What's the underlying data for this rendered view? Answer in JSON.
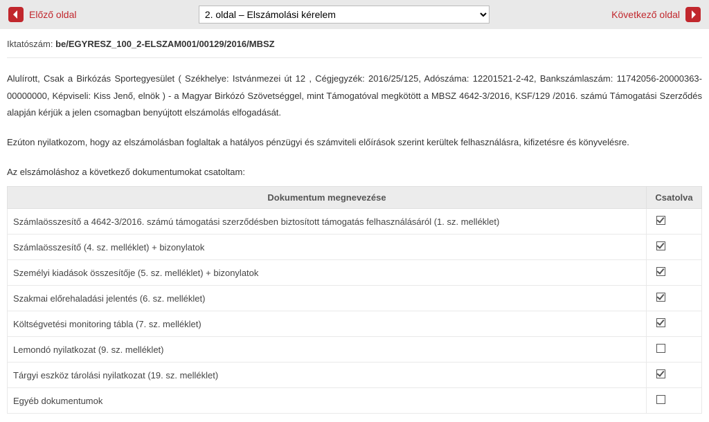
{
  "nav": {
    "prev_label": "Előző oldal",
    "next_label": "Következő oldal",
    "select_value": "2. oldal – Elszámolási kérelem"
  },
  "reference": {
    "label": "Iktatószám:",
    "value": "be/EGYRESZ_100_2-ELSZAM001/00129/2016/MBSZ"
  },
  "paragraphs": {
    "p1": "Alulírott, Csak a Birkózás Sportegyesület ( Székhelye: Istvánmezei út 12 , Cégjegyzék: 2016/25/125, Adószáma: 12201521-2-42, Bankszámlaszám: 11742056-20000363-00000000, Képviseli: Kiss Jenő, elnök ) - a Magyar Birkózó Szövetséggel, mint Támogatóval megkötött a MBSZ 4642-3/2016, KSF/129 /2016. számú Támogatási Szerződés alapján kérjük a jelen csomagban benyújtott elszámolás elfogadását.",
    "p2": "Ezúton nyilatkozom, hogy az elszámolásban foglaltak a hatályos pénzügyi és számviteli előírások szerint kerültek felhasználásra, kifizetésre és könyvelésre.",
    "p3": "Az elszámoláshoz a következő dokumentumokat csatoltam:"
  },
  "table": {
    "header_name": "Dokumentum megnevezése",
    "header_attached": "Csatolva",
    "rows": [
      {
        "name": "Számlaösszesítő a 4642-3/2016. számú támogatási szerződésben biztosított támogatás felhasználásáról (1. sz. melléklet)",
        "checked": true
      },
      {
        "name": "Számlaösszesítő (4. sz. melléklet) + bizonylatok",
        "checked": true
      },
      {
        "name": "Személyi kiadások összesítője (5. sz. melléklet) + bizonylatok",
        "checked": true
      },
      {
        "name": "Szakmai előrehaladási jelentés (6. sz. melléklet)",
        "checked": true
      },
      {
        "name": "Költségvetési monitoring tábla (7. sz. melléklet)",
        "checked": true
      },
      {
        "name": "Lemondó nyilatkozat (9. sz. melléklet)",
        "checked": false
      },
      {
        "name": "Tárgyi eszköz tárolási nyilatkozat (19. sz. melléklet)",
        "checked": true
      },
      {
        "name": "Egyéb dokumentumok",
        "checked": false
      }
    ]
  }
}
